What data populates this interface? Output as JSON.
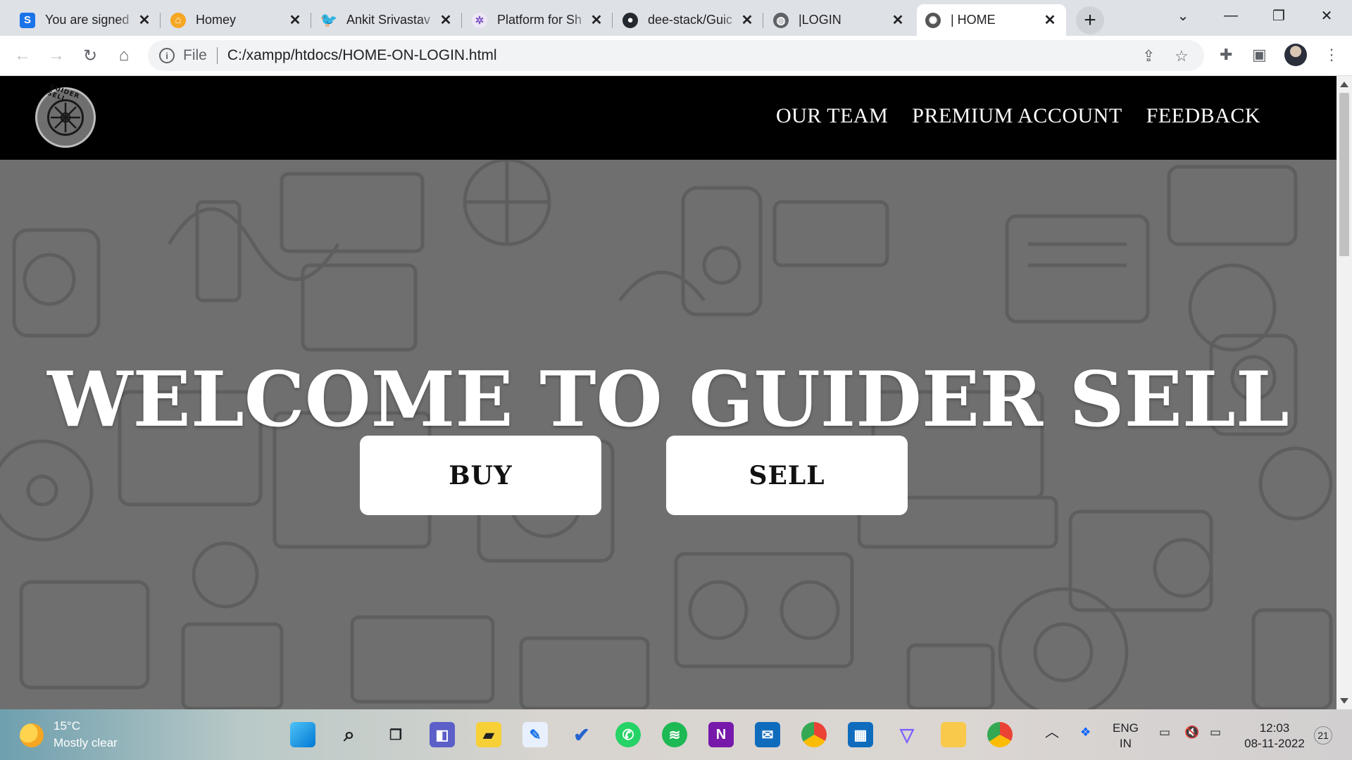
{
  "browser": {
    "tabs": [
      {
        "title": "You are signed",
        "icon": "s-logo-icon",
        "color": "#1a73e8",
        "glyph": "S"
      },
      {
        "title": "Homey",
        "icon": "homey-icon",
        "color": "#f5a623",
        "glyph": "⌂"
      },
      {
        "title": "Ankit Srivastav",
        "icon": "twitter-icon",
        "color": "#1d9bf0",
        "glyph": "🐦"
      },
      {
        "title": "Platform for Sh",
        "icon": "platform-icon",
        "color": "#b39ddb",
        "glyph": "✲"
      },
      {
        "title": "dee-stack/Guic",
        "icon": "github-icon",
        "color": "#24292f",
        "glyph": "●"
      },
      {
        "title": "|LOGIN",
        "icon": "globe-icon",
        "color": "#5f6368",
        "glyph": "◍"
      },
      {
        "title": "| HOME",
        "icon": "guider-sell-icon",
        "color": "#555555",
        "glyph": "✺"
      }
    ],
    "address": {
      "scheme_label": "File",
      "url": "C:/xampp/htdocs/HOME-ON-LOGIN.html"
    }
  },
  "site": {
    "logo_text": "GUIDER SELL",
    "nav": [
      "OUR TEAM",
      "PREMIUM ACCOUNT",
      "FEEDBACK"
    ],
    "hero_title": "WELCOME TO GUIDER SELL",
    "buy_label": "BUY",
    "sell_label": "SELL"
  },
  "taskbar": {
    "weather_temp": "15°C",
    "weather_desc": "Mostly clear",
    "lang_top": "ENG",
    "lang_bottom": "IN",
    "time": "12:03",
    "date": "08-11-2022",
    "notification_count": "21"
  },
  "colors": {
    "navbar_bg": "#000000",
    "hero_bg": "#6f6f6f",
    "button_bg": "#ffffff"
  }
}
